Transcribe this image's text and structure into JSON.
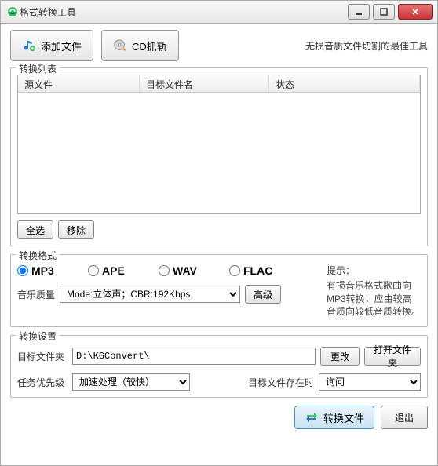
{
  "window": {
    "title": "格式转换工具"
  },
  "toolbar": {
    "add_file": "添加文件",
    "cd_grab": "CD抓轨",
    "tagline": "无损音质文件切割的最佳工具"
  },
  "list_group": {
    "label": "转换列表",
    "columns": {
      "source": "源文件",
      "target": "目标文件名",
      "status": "状态"
    },
    "select_all": "全选",
    "remove": "移除"
  },
  "format_group": {
    "label": "转换格式",
    "options": {
      "mp3": "MP3",
      "ape": "APE",
      "wav": "WAV",
      "flac": "FLAC"
    },
    "selected": "mp3",
    "hint_title": "提示：",
    "hint_body": "有损音乐格式歌曲向MP3转换，应由较高音质向较低音质转换。",
    "quality_label": "音乐质量",
    "quality_value": "Mode:立体声；CBR:192Kbps",
    "advanced": "高级"
  },
  "settings_group": {
    "label": "转换设置",
    "target_folder_label": "目标文件夹",
    "target_folder_value": "D:\\KGConvert\\",
    "change": "更改",
    "open_folder": "打开文件夹",
    "priority_label": "任务优先级",
    "priority_value": "加速处理（较快）",
    "exists_label": "目标文件存在时",
    "exists_value": "询问"
  },
  "footer": {
    "convert": "转换文件",
    "exit": "退出"
  }
}
